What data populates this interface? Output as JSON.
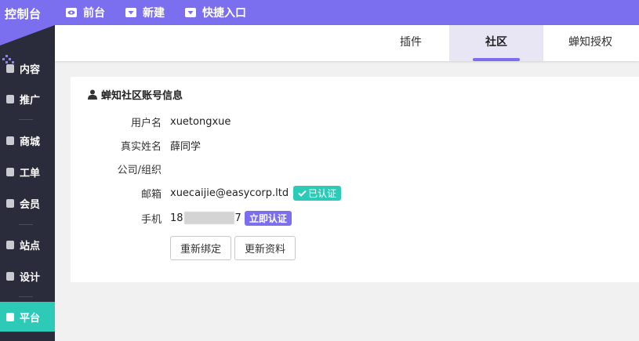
{
  "app": {
    "logo": "控制台"
  },
  "topnav": [
    {
      "label": "前台",
      "icon": "eye-icon"
    },
    {
      "label": "新建",
      "icon": "caret-down-icon"
    },
    {
      "label": "快捷入口",
      "icon": "caret-down-icon"
    }
  ],
  "sidebar": {
    "items": [
      {
        "label": "内容",
        "icon": "document-icon"
      },
      {
        "label": "推广",
        "icon": "cube-icon"
      },
      {
        "label": "商城",
        "icon": "mail-icon"
      },
      {
        "label": "工单",
        "icon": "file-icon"
      },
      {
        "label": "会员",
        "icon": "diamond-icon"
      },
      {
        "label": "站点",
        "icon": "map-pin-icon"
      },
      {
        "label": "设计",
        "icon": "image-icon"
      },
      {
        "label": "平台",
        "icon": "grid-icon",
        "active": true
      }
    ]
  },
  "tabs": [
    {
      "label": "插件"
    },
    {
      "label": "社区",
      "active": true
    },
    {
      "label": "蝉知授权"
    }
  ],
  "account": {
    "title": "蝉知社区账号信息",
    "fields": [
      {
        "label": "用户名",
        "value": "xuetongxue"
      },
      {
        "label": "真实姓名",
        "value": "薛同学"
      },
      {
        "label": "公司/组织",
        "value": ""
      },
      {
        "label": "邮箱",
        "value": "xuecaijie@easycorp.ltd",
        "badge": "已认证"
      },
      {
        "label": "手机",
        "value_prefix": "18",
        "value_suffix": "7",
        "badge": "立即认证"
      }
    ],
    "buttons": {
      "rebind": "重新绑定",
      "update": "更新资料"
    }
  },
  "colors": {
    "brand": "#7b6ff0",
    "active_nav": "#2dcbb7",
    "sidebar_bg": "#2a2c3b"
  }
}
